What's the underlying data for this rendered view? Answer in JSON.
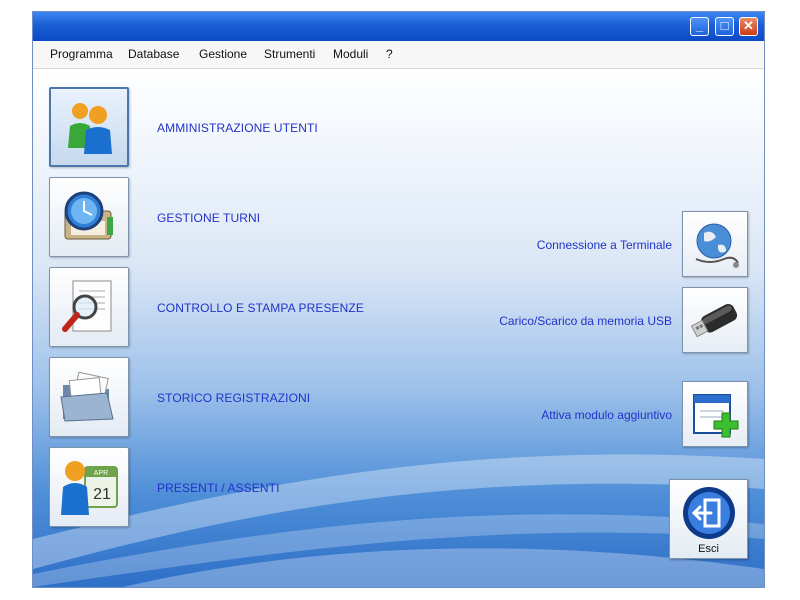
{
  "window": {
    "controls": {
      "minimize": "_",
      "maximize": "□",
      "close": "✕"
    }
  },
  "menu": [
    "Programma",
    "Database",
    "Gestione",
    "Strumenti",
    "Moduli",
    "?"
  ],
  "main_buttons": [
    {
      "label": "AMMINISTRAZIONE UTENTI",
      "icon": "users-admin-icon"
    },
    {
      "label": "GESTIONE TURNI",
      "icon": "shifts-clock-icon"
    },
    {
      "label": "CONTROLLO E STAMPA PRESENZE",
      "icon": "magnifier-document-icon"
    },
    {
      "label": "STORICO REGISTRAZIONI",
      "icon": "folder-documents-icon"
    },
    {
      "label": "PRESENTI / ASSENTI",
      "icon": "user-calendar-icon"
    }
  ],
  "calendar_icon": {
    "month": "APR",
    "day": "21"
  },
  "side_buttons": [
    {
      "label": "Connessione a Terminale",
      "icon": "globe-network-icon"
    },
    {
      "label": "Carico/Scarico da memoria USB",
      "icon": "usb-drive-icon"
    },
    {
      "label": "Attiva modulo aggiuntivo",
      "icon": "add-module-icon"
    }
  ],
  "exit_button": {
    "label": "Esci",
    "icon": "exit-door-icon"
  },
  "colors": {
    "titlebar": "#1a5fd6",
    "link_text": "#2233c8",
    "background_bottom": "#2e6fc8"
  }
}
